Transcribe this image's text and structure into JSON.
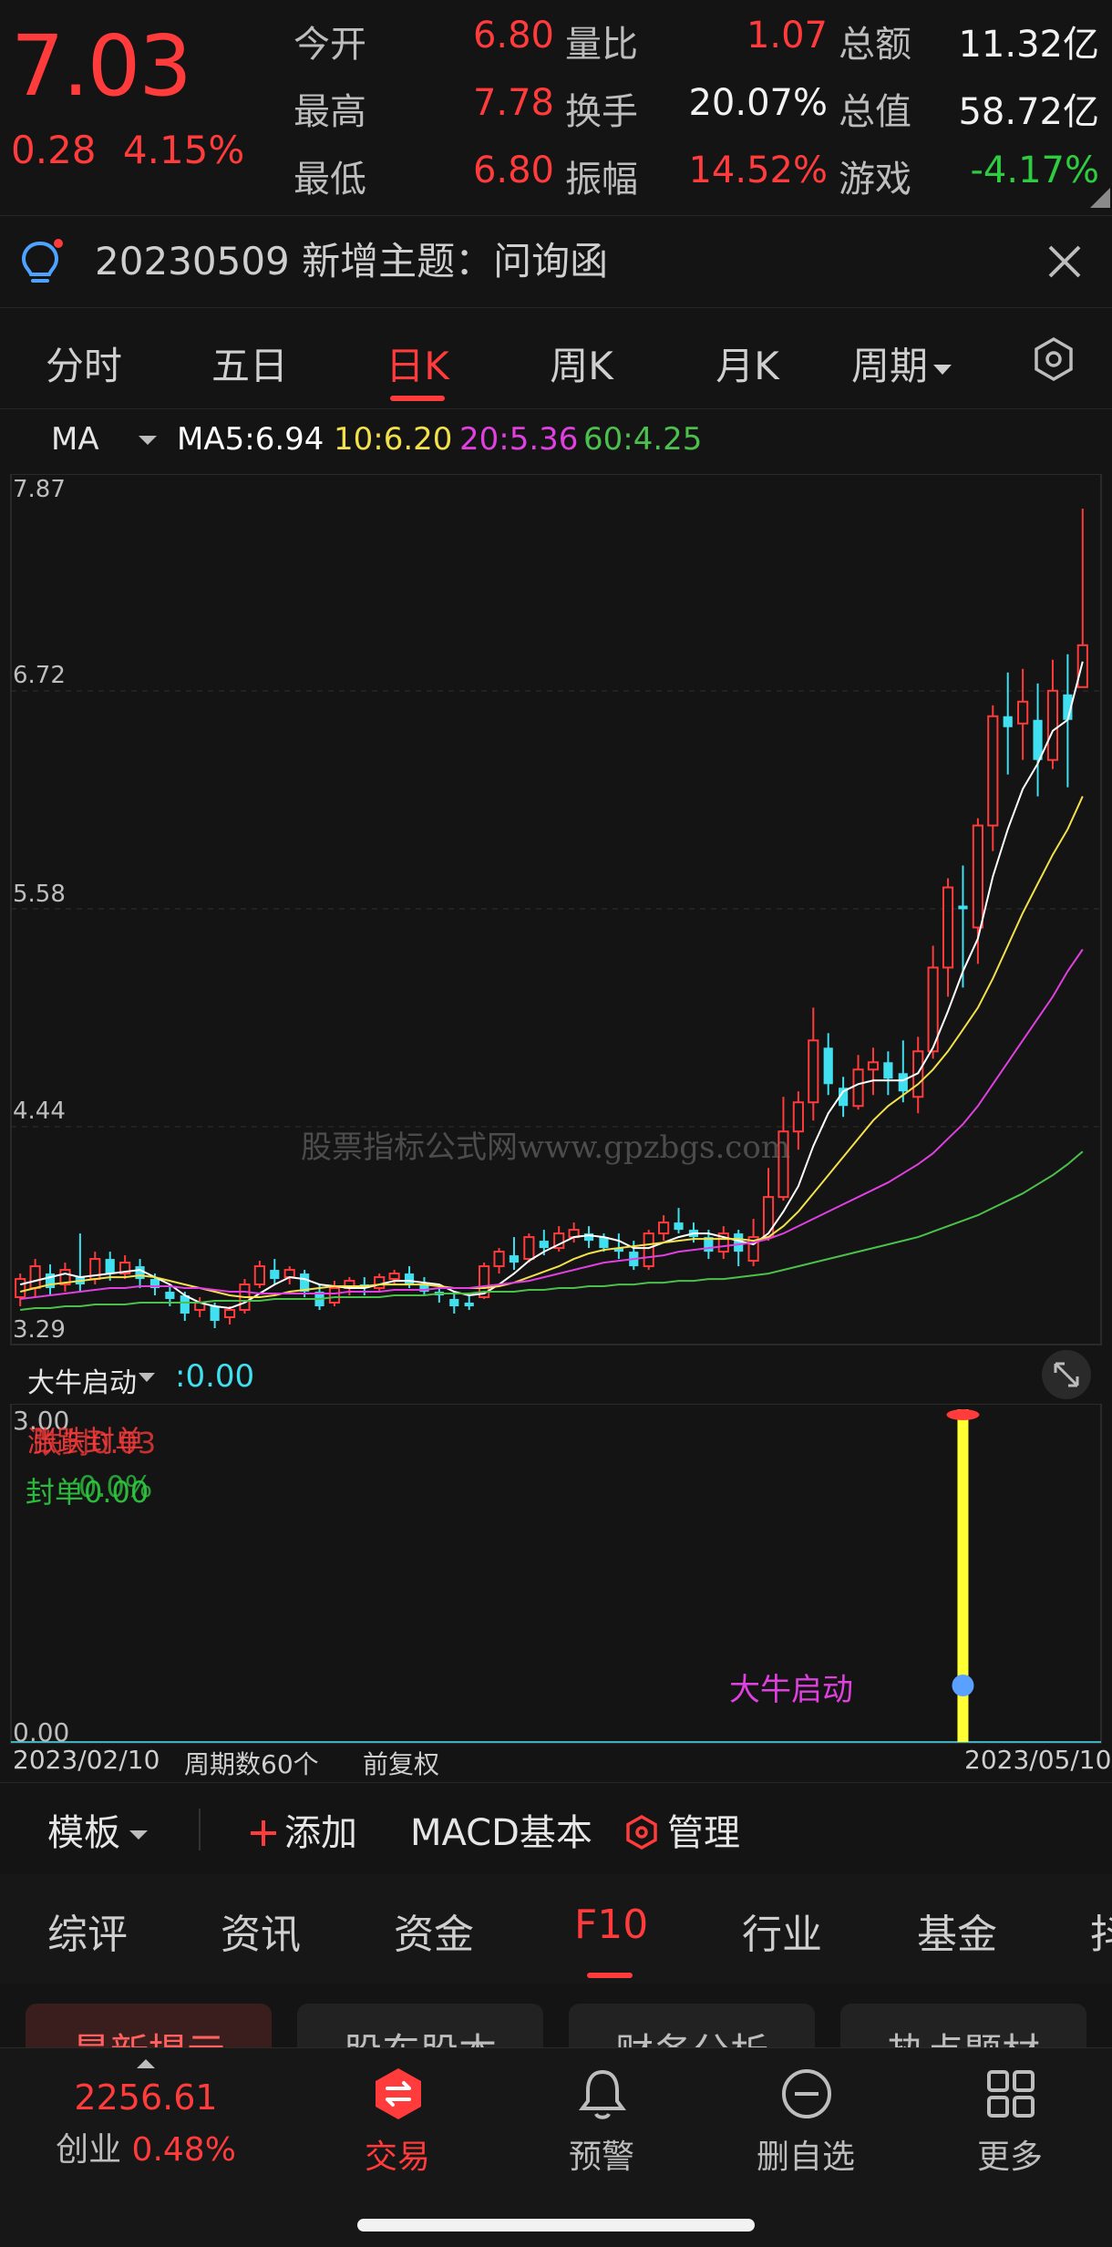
{
  "quote": {
    "price": "7.03",
    "change": "0.28",
    "change_pct": "4.15%",
    "rows": [
      [
        {
          "label": "今开",
          "value": "6.80",
          "color": "red"
        },
        {
          "label": "量比",
          "value": "1.07",
          "color": "red"
        },
        {
          "label": "总额",
          "value": "11.32亿",
          "color": "white"
        }
      ],
      [
        {
          "label": "最高",
          "value": "7.78",
          "color": "red"
        },
        {
          "label": "换手",
          "value": "20.07%",
          "color": "white"
        },
        {
          "label": "总值",
          "value": "58.72亿",
          "color": "white"
        }
      ],
      [
        {
          "label": "最低",
          "value": "6.80",
          "color": "red"
        },
        {
          "label": "振幅",
          "value": "14.52%",
          "color": "red"
        },
        {
          "label": "游戏",
          "value": "-4.17%",
          "color": "green",
          "label_color": "orange"
        }
      ]
    ]
  },
  "banner": {
    "text": "20230509 新增主题：问询函"
  },
  "tabs": [
    "分时",
    "五日",
    "日K",
    "周K",
    "月K",
    "周期"
  ],
  "active_tab": 2,
  "ma": {
    "selector": "MA",
    "items": [
      {
        "label": "MA5:",
        "value": "6.94",
        "color": "#ffffff"
      },
      {
        "label": "10:",
        "value": "6.20",
        "color": "#f2e14a"
      },
      {
        "label": "20:",
        "value": "5.36",
        "color": "#e040e0"
      },
      {
        "label": "60:",
        "value": "4.25",
        "color": "#4cc04c"
      }
    ]
  },
  "chart_data": {
    "type": "candlestick",
    "y_ticks": [
      "7.87",
      "6.72",
      "5.58",
      "4.44",
      "3.29"
    ],
    "ylim": [
      3.29,
      7.87
    ],
    "candles": [
      [
        3.45,
        3.55,
        3.4,
        3.58
      ],
      [
        3.5,
        3.62,
        3.45,
        3.66
      ],
      [
        3.58,
        3.5,
        3.46,
        3.63
      ],
      [
        3.52,
        3.6,
        3.48,
        3.64
      ],
      [
        3.56,
        3.52,
        3.48,
        3.8
      ],
      [
        3.55,
        3.66,
        3.52,
        3.7
      ],
      [
        3.66,
        3.58,
        3.54,
        3.7
      ],
      [
        3.58,
        3.64,
        3.55,
        3.68
      ],
      [
        3.62,
        3.55,
        3.5,
        3.66
      ],
      [
        3.55,
        3.5,
        3.46,
        3.58
      ],
      [
        3.48,
        3.44,
        3.4,
        3.52
      ],
      [
        3.46,
        3.36,
        3.32,
        3.48
      ],
      [
        3.38,
        3.42,
        3.34,
        3.45
      ],
      [
        3.4,
        3.32,
        3.28,
        3.42
      ],
      [
        3.34,
        3.38,
        3.3,
        3.4
      ],
      [
        3.38,
        3.52,
        3.36,
        3.55
      ],
      [
        3.52,
        3.62,
        3.5,
        3.65
      ],
      [
        3.6,
        3.55,
        3.52,
        3.66
      ],
      [
        3.56,
        3.6,
        3.52,
        3.62
      ],
      [
        3.58,
        3.48,
        3.45,
        3.6
      ],
      [
        3.48,
        3.4,
        3.38,
        3.52
      ],
      [
        3.42,
        3.5,
        3.4,
        3.54
      ],
      [
        3.5,
        3.54,
        3.46,
        3.56
      ],
      [
        3.52,
        3.5,
        3.46,
        3.56
      ],
      [
        3.5,
        3.56,
        3.48,
        3.58
      ],
      [
        3.55,
        3.58,
        3.52,
        3.6
      ],
      [
        3.58,
        3.52,
        3.5,
        3.62
      ],
      [
        3.52,
        3.48,
        3.46,
        3.56
      ],
      [
        3.48,
        3.46,
        3.42,
        3.52
      ],
      [
        3.44,
        3.4,
        3.36,
        3.48
      ],
      [
        3.42,
        3.4,
        3.38,
        3.46
      ],
      [
        3.45,
        3.62,
        3.44,
        3.64
      ],
      [
        3.62,
        3.7,
        3.58,
        3.72
      ],
      [
        3.68,
        3.64,
        3.6,
        3.78
      ],
      [
        3.66,
        3.78,
        3.64,
        3.8
      ],
      [
        3.76,
        3.72,
        3.68,
        3.82
      ],
      [
        3.72,
        3.8,
        3.7,
        3.84
      ],
      [
        3.78,
        3.82,
        3.75,
        3.86
      ],
      [
        3.8,
        3.76,
        3.72,
        3.84
      ],
      [
        3.78,
        3.72,
        3.7,
        3.8
      ],
      [
        3.72,
        3.7,
        3.66,
        3.8
      ],
      [
        3.7,
        3.62,
        3.6,
        3.76
      ],
      [
        3.62,
        3.8,
        3.6,
        3.82
      ],
      [
        3.8,
        3.86,
        3.76,
        3.9
      ],
      [
        3.86,
        3.82,
        3.8,
        3.94
      ],
      [
        3.82,
        3.78,
        3.75,
        3.86
      ],
      [
        3.78,
        3.7,
        3.66,
        3.82
      ],
      [
        3.7,
        3.8,
        3.66,
        3.84
      ],
      [
        3.8,
        3.7,
        3.62,
        3.82
      ],
      [
        3.65,
        3.78,
        3.62,
        3.88
      ],
      [
        3.78,
        4.0,
        3.76,
        4.16
      ],
      [
        4.0,
        4.36,
        3.98,
        4.55
      ],
      [
        4.36,
        4.52,
        4.26,
        4.58
      ],
      [
        4.52,
        4.86,
        4.42,
        5.04
      ],
      [
        4.82,
        4.62,
        4.56,
        4.9
      ],
      [
        4.6,
        4.5,
        4.44,
        4.66
      ],
      [
        4.5,
        4.7,
        4.48,
        4.78
      ],
      [
        4.7,
        4.74,
        4.56,
        4.82
      ],
      [
        4.74,
        4.65,
        4.56,
        4.8
      ],
      [
        4.68,
        4.58,
        4.52,
        4.86
      ],
      [
        4.55,
        4.8,
        4.46,
        4.88
      ],
      [
        4.8,
        5.26,
        4.76,
        5.38
      ],
      [
        5.26,
        5.7,
        5.1,
        5.75
      ],
      [
        5.6,
        5.58,
        5.15,
        5.82
      ],
      [
        5.48,
        6.04,
        5.28,
        6.08
      ],
      [
        6.04,
        6.64,
        5.9,
        6.7
      ],
      [
        6.64,
        6.58,
        6.32,
        6.88
      ],
      [
        6.6,
        6.72,
        6.4,
        6.9
      ],
      [
        6.62,
        6.4,
        6.2,
        6.82
      ],
      [
        6.4,
        6.78,
        6.35,
        6.95
      ],
      [
        6.76,
        6.62,
        6.25,
        6.98
      ],
      [
        6.8,
        7.03,
        6.8,
        7.78
      ]
    ],
    "ma5": [
      3.52,
      3.54,
      3.56,
      3.58,
      3.56,
      3.57,
      3.58,
      3.59,
      3.6,
      3.56,
      3.52,
      3.46,
      3.42,
      3.4,
      3.39,
      3.42,
      3.47,
      3.52,
      3.56,
      3.55,
      3.52,
      3.51,
      3.5,
      3.5,
      3.52,
      3.54,
      3.54,
      3.53,
      3.52,
      3.48,
      3.46,
      3.47,
      3.52,
      3.58,
      3.65,
      3.7,
      3.74,
      3.78,
      3.79,
      3.78,
      3.76,
      3.72,
      3.72,
      3.75,
      3.78,
      3.8,
      3.8,
      3.78,
      3.76,
      3.74,
      3.8,
      3.92,
      4.06,
      4.28,
      4.46,
      4.58,
      4.62,
      4.64,
      4.64,
      4.64,
      4.68,
      4.82,
      5.02,
      5.24,
      5.42,
      5.76,
      6.02,
      6.24,
      6.38,
      6.56,
      6.62,
      6.94
    ],
    "ma10": [
      3.48,
      3.5,
      3.52,
      3.53,
      3.54,
      3.55,
      3.56,
      3.56,
      3.57,
      3.56,
      3.54,
      3.52,
      3.5,
      3.48,
      3.46,
      3.45,
      3.45,
      3.46,
      3.48,
      3.49,
      3.5,
      3.51,
      3.51,
      3.51,
      3.52,
      3.52,
      3.52,
      3.52,
      3.51,
      3.5,
      3.5,
      3.5,
      3.51,
      3.53,
      3.56,
      3.59,
      3.62,
      3.66,
      3.69,
      3.71,
      3.72,
      3.73,
      3.74,
      3.75,
      3.76,
      3.77,
      3.77,
      3.77,
      3.77,
      3.76,
      3.78,
      3.84,
      3.92,
      4.02,
      4.12,
      4.22,
      4.32,
      4.42,
      4.5,
      4.56,
      4.62,
      4.7,
      4.8,
      4.92,
      5.04,
      5.2,
      5.38,
      5.56,
      5.72,
      5.88,
      6.02,
      6.2
    ],
    "ma20": [
      3.44,
      3.45,
      3.46,
      3.47,
      3.48,
      3.49,
      3.5,
      3.5,
      3.51,
      3.51,
      3.51,
      3.5,
      3.5,
      3.49,
      3.48,
      3.48,
      3.47,
      3.47,
      3.47,
      3.47,
      3.47,
      3.47,
      3.48,
      3.48,
      3.48,
      3.49,
      3.49,
      3.49,
      3.5,
      3.5,
      3.5,
      3.51,
      3.52,
      3.53,
      3.54,
      3.56,
      3.58,
      3.6,
      3.62,
      3.64,
      3.65,
      3.66,
      3.67,
      3.68,
      3.7,
      3.71,
      3.72,
      3.73,
      3.74,
      3.75,
      3.77,
      3.8,
      3.84,
      3.88,
      3.92,
      3.96,
      4.0,
      4.04,
      4.08,
      4.13,
      4.18,
      4.24,
      4.32,
      4.4,
      4.5,
      4.62,
      4.74,
      4.86,
      4.98,
      5.1,
      5.24,
      5.36
    ],
    "ma60": [
      3.38,
      3.39,
      3.39,
      3.4,
      3.4,
      3.41,
      3.41,
      3.41,
      3.42,
      3.42,
      3.42,
      3.42,
      3.42,
      3.43,
      3.43,
      3.43,
      3.43,
      3.44,
      3.44,
      3.44,
      3.44,
      3.45,
      3.45,
      3.45,
      3.45,
      3.46,
      3.46,
      3.46,
      3.47,
      3.47,
      3.47,
      3.48,
      3.48,
      3.48,
      3.49,
      3.49,
      3.5,
      3.5,
      3.51,
      3.51,
      3.52,
      3.52,
      3.53,
      3.53,
      3.54,
      3.54,
      3.55,
      3.55,
      3.56,
      3.57,
      3.58,
      3.6,
      3.62,
      3.64,
      3.66,
      3.68,
      3.7,
      3.72,
      3.74,
      3.76,
      3.78,
      3.81,
      3.84,
      3.87,
      3.9,
      3.94,
      3.98,
      4.02,
      4.07,
      4.12,
      4.18,
      4.25
    ]
  },
  "watermark": "股票指标公式网www.gpzbgs.com",
  "indicator": {
    "name": "大牛启动",
    "value": ":0.00",
    "y_top": "3.00",
    "y_bottom": "0.00",
    "overlay_red": "涨跌封单",
    "overlay_red2": "跌封0.03",
    "overlay_green": "封单0.00",
    "overlay_green2": "0.0%",
    "signal_label": "大牛启动",
    "signal_index": 63,
    "signal_value": 3.0
  },
  "axis": {
    "start": "2023/02/10",
    "count": "周期数60个",
    "adjust": "前复权",
    "end": "2023/05/10"
  },
  "toolbar": {
    "template": "模板",
    "add": "添加",
    "macd": "MACD基本",
    "manage": "管理"
  },
  "info_tabs": [
    "综评",
    "资讯",
    "资金",
    "F10",
    "行业",
    "基金",
    "抖"
  ],
  "info_active": 3,
  "pills": [
    "最新提示",
    "股东股本",
    "财务分析",
    "热点题材"
  ],
  "bottom_nav": {
    "index_value": "2256.61",
    "index_name": "创业",
    "index_pct": "0.48%",
    "items": [
      "交易",
      "预警",
      "删自选",
      "更多"
    ]
  },
  "colors": {
    "up": "#ff3b3b",
    "down": "#40e0f0",
    "bg": "#141414"
  }
}
